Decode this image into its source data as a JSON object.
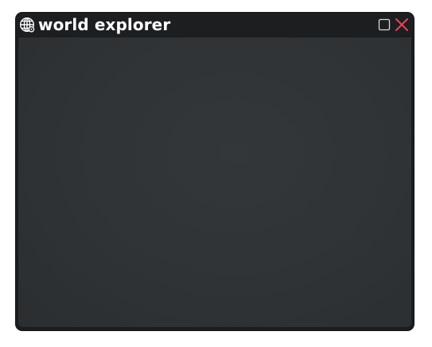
{
  "window": {
    "title": "world explorer",
    "app_icon": "globe-icon",
    "controls": {
      "maximize_icon": "maximize-icon",
      "close_icon": "close-icon"
    }
  },
  "colors": {
    "titlebar": "#1d1e20",
    "content": "#303436",
    "title_text": "#ffffff",
    "close": "#e8455a"
  }
}
